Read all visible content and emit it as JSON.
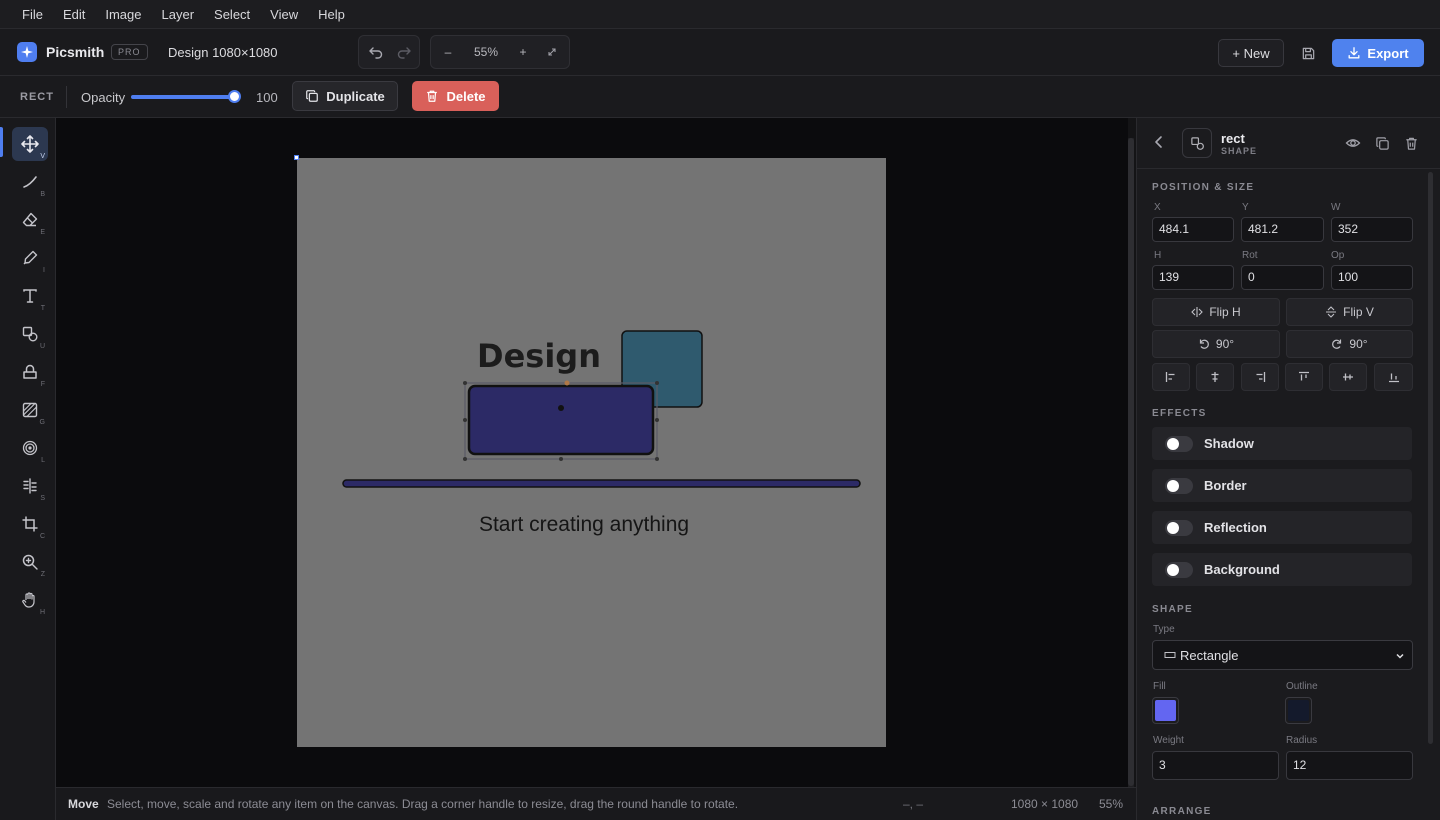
{
  "menubar": {
    "items": [
      "File",
      "Edit",
      "Image",
      "Layer",
      "Select",
      "View",
      "Help"
    ]
  },
  "header": {
    "app_name": "Picsmith",
    "badge": "PRO",
    "document_title": "Design 1080×1080",
    "zoom": "55%",
    "zoom_out": "–",
    "zoom_in": "+",
    "new_label": "+ New",
    "export_label": "Export",
    "accent": "#4f82ee"
  },
  "context_bar": {
    "selection_type": "RECT",
    "opacity_label": "Opacity",
    "opacity_value": "100",
    "opacity_fraction": 1.0,
    "duplicate_label": "Duplicate",
    "delete_label": "Delete",
    "delete_color": "#d9605a"
  },
  "toolbar": {
    "tools": [
      {
        "name": "move",
        "key": "V",
        "icon": "move-icon",
        "active": true
      },
      {
        "name": "line",
        "key": "B",
        "icon": "line-icon"
      },
      {
        "name": "eraser",
        "key": "E",
        "icon": "eraser-icon"
      },
      {
        "name": "picker",
        "key": "I",
        "icon": "eyedropper-icon"
      },
      {
        "name": "text",
        "key": "T",
        "icon": "text-icon"
      },
      {
        "name": "shape",
        "key": "U",
        "icon": "shape-icon"
      },
      {
        "name": "fill",
        "key": "F",
        "icon": "fill-icon"
      },
      {
        "name": "gradient",
        "key": "G",
        "icon": "gradient-icon"
      },
      {
        "name": "blur",
        "key": "L",
        "icon": "blur-icon"
      },
      {
        "name": "split",
        "key": "S",
        "icon": "split-icon"
      },
      {
        "name": "crop",
        "key": "C",
        "icon": "crop-icon"
      },
      {
        "name": "zoom",
        "key": "Z",
        "icon": "zoom-icon"
      },
      {
        "name": "hand",
        "key": "H",
        "icon": "hand-icon"
      }
    ]
  },
  "canvas": {
    "heading": "Design",
    "subtitle": "Start creating anything",
    "artboard_color": "#747474",
    "rect_fill": "#2c2a66",
    "square_fill": "#2f5a6e",
    "bar_fill": "#2c2a66"
  },
  "status": {
    "mode": "Move",
    "hint": "Select, move, scale and rotate any item on the canvas. Drag a corner handle to resize, drag the round handle to rotate.",
    "coords": "–, –",
    "size": "1080 × 1080",
    "zoom": "55%"
  },
  "panel": {
    "name": "rect",
    "type": "SHAPE",
    "position_title": "POSITION & SIZE",
    "fields": [
      {
        "label": "X",
        "value": "484.1"
      },
      {
        "label": "Y",
        "value": "481.2"
      },
      {
        "label": "W",
        "value": "352"
      },
      {
        "label": "H",
        "value": "139"
      },
      {
        "label": "Rot",
        "value": "0"
      },
      {
        "label": "Op",
        "value": "100"
      }
    ],
    "flip_h": "Flip H",
    "flip_v": "Flip V",
    "rotate_ccw": "90°",
    "rotate_cw": "90°",
    "effects_title": "EFFECTS",
    "effects": [
      "Shadow",
      "Border",
      "Reflection",
      "Background"
    ],
    "shape_title": "SHAPE",
    "type_label": "Type",
    "type_value": "Rectangle",
    "fill_label": "Fill",
    "fill_color": "#6366f1",
    "outline_label": "Outline",
    "outline_color": "#141a2c",
    "weight_label": "Weight",
    "weight_value": "3",
    "radius_label": "Radius",
    "radius_value": "12",
    "arrange_title": "ARRANGE"
  }
}
